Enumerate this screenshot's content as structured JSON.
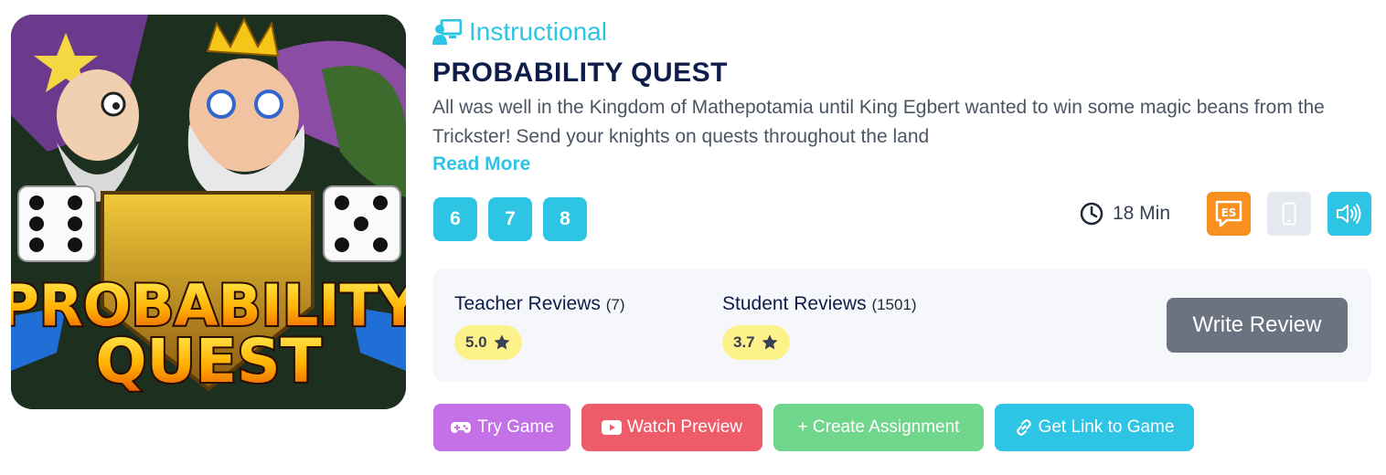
{
  "game": {
    "category": "Instructional",
    "title": "PROBABILITY QUEST",
    "description": "All was well in the Kingdom of Mathepotamia until King Egbert wanted to win some magic beans from the Trickster! Send your knights on quests throughout the land",
    "read_more": "Read More",
    "cover": {
      "line1": "PROBABILITY",
      "line2": "QUEST"
    }
  },
  "grades": [
    "6",
    "7",
    "8"
  ],
  "meta": {
    "duration": "18 Min",
    "icons": [
      "clock-icon",
      "spanish-es-icon",
      "mobile-icon",
      "audio-icon"
    ]
  },
  "reviews": {
    "teacher": {
      "label": "Teacher Reviews",
      "count": "(7)",
      "rating": "5.0"
    },
    "student": {
      "label": "Student Reviews",
      "count": "(1501)",
      "rating": "3.7"
    },
    "write_label": "Write Review"
  },
  "actions": {
    "try": "Try Game",
    "watch": "Watch Preview",
    "create": "+ Create Assignment",
    "link": "Get Link to Game"
  },
  "colors": {
    "accent": "#2ec4e4",
    "title": "#0f1d4a",
    "es_badge": "#f7901e",
    "try": "#c470e6",
    "watch": "#ef5c69",
    "create": "#6fd68c",
    "link": "#2ec4e4",
    "rating_bg": "#fdf28a",
    "write_review": "#6b7280"
  }
}
